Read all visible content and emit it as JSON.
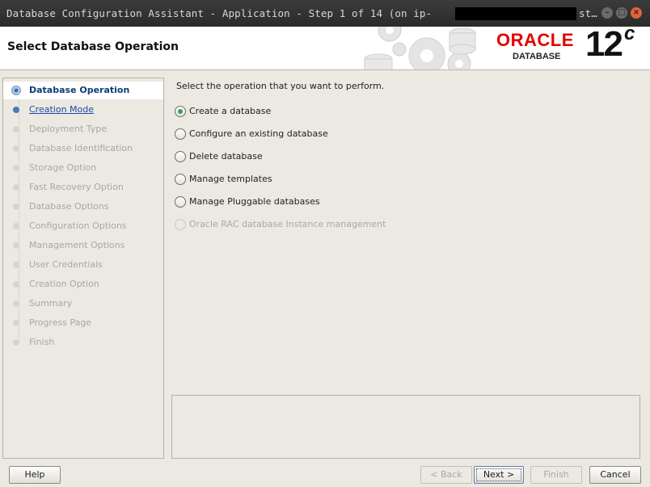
{
  "window": {
    "title": "Database Configuration Assistant - Application - Step 1 of 14 (on ip-",
    "title_tail": "st…",
    "controls": {
      "minimize": "–",
      "maximize": "□",
      "close": "×"
    }
  },
  "header": {
    "title": "Select Database Operation",
    "brand": "ORACLE",
    "brand_sub": "DATABASE",
    "version": "12",
    "version_sup": "c",
    "brand_color": "#e30000"
  },
  "steps": [
    {
      "label": "Database Operation",
      "state": "active"
    },
    {
      "label": "Creation Mode",
      "state": "link"
    },
    {
      "label": "Deployment Type",
      "state": "disabled"
    },
    {
      "label": "Database Identification",
      "state": "disabled"
    },
    {
      "label": "Storage Option",
      "state": "disabled"
    },
    {
      "label": "Fast Recovery Option",
      "state": "disabled"
    },
    {
      "label": "Database Options",
      "state": "disabled"
    },
    {
      "label": "Configuration Options",
      "state": "disabled"
    },
    {
      "label": "Management Options",
      "state": "disabled"
    },
    {
      "label": "User Credentials",
      "state": "disabled"
    },
    {
      "label": "Creation Option",
      "state": "disabled"
    },
    {
      "label": "Summary",
      "state": "disabled"
    },
    {
      "label": "Progress Page",
      "state": "disabled"
    },
    {
      "label": "Finish",
      "state": "disabled"
    }
  ],
  "main": {
    "instruction": "Select the operation that you want to perform.",
    "options": [
      {
        "label": "Create a database",
        "selected": true,
        "enabled": true
      },
      {
        "label": "Configure an existing database",
        "selected": false,
        "enabled": true
      },
      {
        "label": "Delete database",
        "selected": false,
        "enabled": true
      },
      {
        "label": "Manage templates",
        "selected": false,
        "enabled": true
      },
      {
        "label": "Manage Pluggable databases",
        "selected": false,
        "enabled": true
      },
      {
        "label": "Oracle RAC database Instance management",
        "selected": false,
        "enabled": false
      }
    ]
  },
  "buttons": {
    "help": "Help",
    "back": "< Back",
    "next": "Next >",
    "finish": "Finish",
    "cancel": "Cancel"
  }
}
